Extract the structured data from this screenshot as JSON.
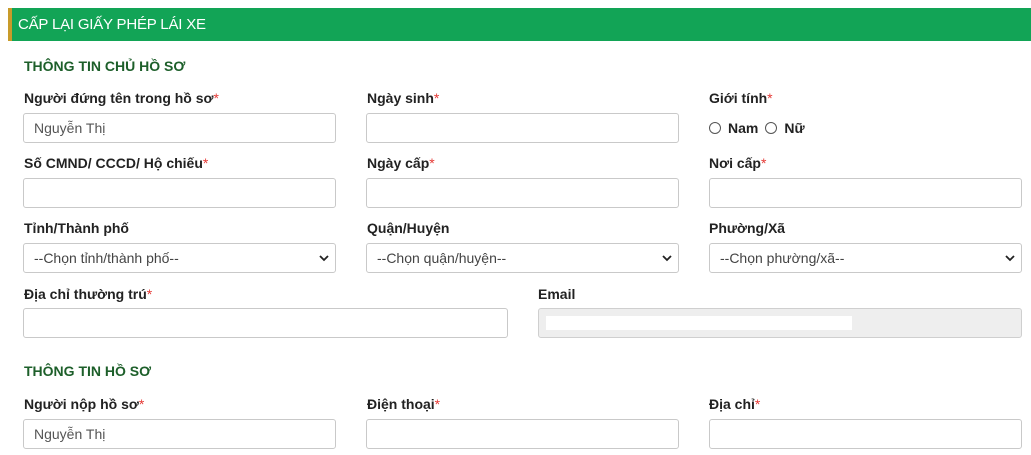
{
  "header": {
    "title": "CẤP LẠI GIẤY PHÉP LÁI XE"
  },
  "owner_section": {
    "title": "THÔNG TIN CHỦ HỒ SƠ",
    "fields": {
      "holder_name": {
        "label": "Người đứng tên trong hồ sơ",
        "value": "Nguyễn Thị"
      },
      "dob": {
        "label": "Ngày sinh",
        "value": ""
      },
      "gender": {
        "label": "Giới tính",
        "options": [
          "Nam",
          "Nữ"
        ]
      },
      "id_number": {
        "label": "Số CMND/ CCCD/ Hộ chiếu",
        "value": ""
      },
      "issue_date": {
        "label": "Ngày cấp",
        "value": ""
      },
      "issue_place": {
        "label": "Nơi cấp",
        "value": ""
      },
      "province": {
        "label": "Tỉnh/Thành phố",
        "selected": "--Chọn tỉnh/thành phố--"
      },
      "district": {
        "label": "Quận/Huyện",
        "selected": "--Chọn quận/huyện--"
      },
      "ward": {
        "label": "Phường/Xã",
        "selected": "--Chọn phường/xã--"
      },
      "address": {
        "label": "Địa chỉ thường trú",
        "value": ""
      },
      "email": {
        "label": "Email",
        "value": ""
      }
    }
  },
  "file_section": {
    "title": "THÔNG TIN HỒ SƠ",
    "fields": {
      "submitter": {
        "label": "Người nộp hồ sơ",
        "value": "Nguyễn Thị"
      },
      "phone": {
        "label": "Điện thoại",
        "value": ""
      },
      "address": {
        "label": "Địa chỉ",
        "value": ""
      }
    }
  },
  "required_mark": "*",
  "colors": {
    "header_bg": "#12a456",
    "section_title": "#1d5f2a",
    "required": "#e53935"
  }
}
